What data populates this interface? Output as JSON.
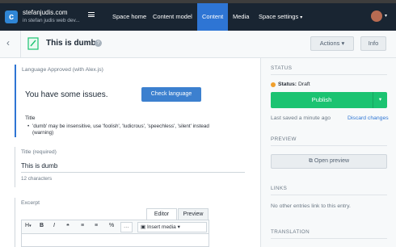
{
  "space": {
    "logo": "c",
    "name": "stefanjudis.com",
    "subtitle": "in stefan judis web dev..."
  },
  "nav": {
    "items": [
      "Space home",
      "Content model",
      "Content",
      "Media",
      "Space settings"
    ],
    "active": "Content"
  },
  "entry": {
    "title": "This is dumb",
    "actions_label": "Actions",
    "info_label": "Info"
  },
  "language_panel": {
    "label": "Language Approved (with Alex.js)",
    "message": "You have some issues.",
    "check_button": "Check language",
    "issue_field": "Title",
    "issue_text": "'dumb' may be insensitive, use 'foolish', 'ludicrous', 'speechless', 'silent' instead (warning)"
  },
  "title_field": {
    "label": "Title (required)",
    "value": "This is dumb",
    "char_count": "12 characters"
  },
  "excerpt_field": {
    "label": "Excerpt",
    "tabs": [
      "Editor",
      "Preview"
    ],
    "toolbar": {
      "heading": "H",
      "bold": "B",
      "italic": "I",
      "quote": "❝",
      "ul": "≡",
      "ol": "≡",
      "link": "%",
      "more": "···",
      "insert_media": "Insert media"
    }
  },
  "sidebar": {
    "status_heading": "STATUS",
    "status_label": "Status:",
    "status_value": "Draft",
    "publish_label": "Publish",
    "saved_text": "Last saved a minute ago",
    "discard_label": "Discard changes",
    "preview_heading": "PREVIEW",
    "preview_button": "Open preview",
    "links_heading": "LINKS",
    "links_empty": "No other entries link to this entry.",
    "translation_heading": "TRANSLATION"
  },
  "colors": {
    "nav_bg": "#192532",
    "nav_active": "#2e75d4",
    "publish": "#1bc371",
    "draft_dot": "#f0a02d",
    "accent_link": "#2e75d4"
  }
}
